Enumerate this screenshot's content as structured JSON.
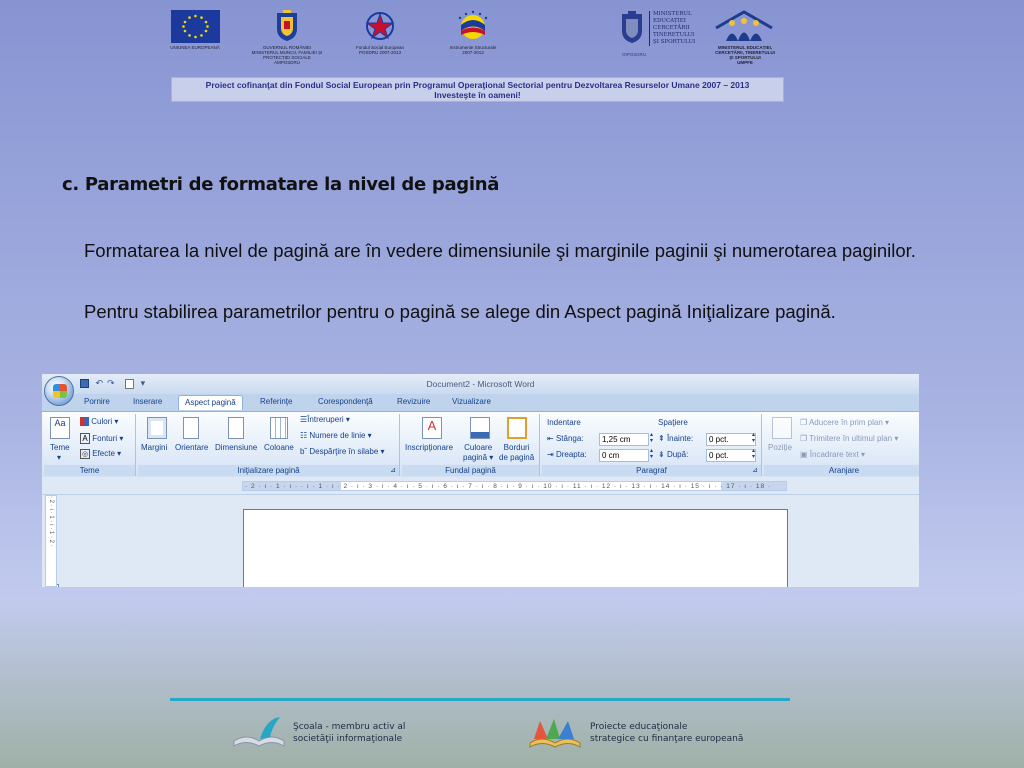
{
  "header": {
    "logos": [
      {
        "icon": "eu-flag-icon",
        "caption": "UNIUNEA EUROPEANĂ"
      },
      {
        "icon": "romania-coat-of-arms-icon",
        "caption": "GUVERNUL ROMÂNIEI\nMINISTERUL MUNCII, FAMILIEI ȘI\nPROTECȚIEI SOCIALE\nAMPOSDRU"
      },
      {
        "icon": "fse-star-icon",
        "caption": "Fondul Social European\nPOSDRU 2007-2013"
      },
      {
        "icon": "structural-instruments-icon",
        "caption": "Instrumente Structurale\n2007-2013"
      },
      {
        "icon": "ministry-education-crest-icon",
        "caption": "OIPOSDRU"
      },
      {
        "icon": "umpfe-logo-icon",
        "caption": "MINISTERUL EDUCAȚIEI,\nCERCETĂRII, TINERETULUI\nȘI SPORTULUI\nUMPFE"
      }
    ],
    "ministry_wordmark": "MINISTERUL\nEDUCAȚIEI\nCERCETĂRII\nTINERETULUI\nȘI SPORTULUI",
    "banner_line1": "Proiect cofinanţat din Fondul Social European prin Programul Operaţional Sectorial pentru Dezvoltarea Resurselor Umane 2007 – 2013",
    "banner_line2": "Investeşte în oameni!"
  },
  "content": {
    "heading": "c. Parametri de formatare la nivel de pagină",
    "paragraph1": "Formatarea la nivel de pagină are în vedere dimensiunile şi marginile paginii şi numerotarea paginilor.",
    "paragraph2": "Pentru stabilirea parametrilor pentru o pagină se alege din Aspect pagină Iniţializare pagină."
  },
  "word": {
    "window_title": "Document2 - Microsoft Word",
    "tabs": [
      "Pornire",
      "Inserare",
      "Aspect pagină",
      "Referinţe",
      "Corespondenţă",
      "Revizuire",
      "Vizualizare"
    ],
    "active_tab": "Aspect pagină",
    "groups": {
      "teme": {
        "label": "Teme",
        "teme": "Teme",
        "culori": "Culori",
        "fonturi": "Fonturi",
        "efecte": "Efecte"
      },
      "init": {
        "label": "Iniţializare pagină",
        "margini": "Margini",
        "orientare": "Orientare",
        "dimensiune": "Dimensiune",
        "coloane": "Coloane",
        "intreruperi": "Întreruperi",
        "numere": "Numere de linie",
        "despartire": "Despărţire în silabe"
      },
      "fundal": {
        "label": "Fundal pagină",
        "inscriptionare": "Inscripţionare",
        "culoare1": "Culoare",
        "culoare2": "pagină",
        "borduri1": "Borduri",
        "borduri2": "de pagină"
      },
      "paragraf": {
        "label": "Paragraf",
        "indentare": "Indentare",
        "stanga": "Stânga:",
        "stanga_val": "1,25 cm",
        "dreapta": "Dreapta:",
        "dreapta_val": "0 cm",
        "spatiere": "Spaţiere",
        "inainte": "Înainte:",
        "inainte_val": "0 pct.",
        "dupa": "După:",
        "dupa_val": "0 pct."
      },
      "aranjare": {
        "label": "Aranjare",
        "pozitie": "Poziție",
        "prim_plan": "Aducere în prim plan",
        "ultim_plan": "Trimitere în ultimul plan",
        "incadrare": "Încadrare text"
      }
    },
    "ruler_text": "· 2 · ı · 1 · ı ·   · ı · 1 · ı · 2 · ı · 3 · ı · 4 · ı · 5 · ı · 6 · ı · 7 · ı · 8 · ı · 9 · ı · 10 · ı · 11 · ı · 12 · ı · 13 · ı · 14 · ı · 15 · ı ·   · 17 · ı · 18 ·",
    "vruler_text": "· 2 · ı · 1 · ı · 1 · 2 ·"
  },
  "footer": {
    "left_line1": "Şcoala - membru activ al",
    "left_line2": "societăţii informaţionale",
    "right_line1": "Proiecte educaţionale",
    "right_line2": "strategice cu finanţare europeană"
  }
}
